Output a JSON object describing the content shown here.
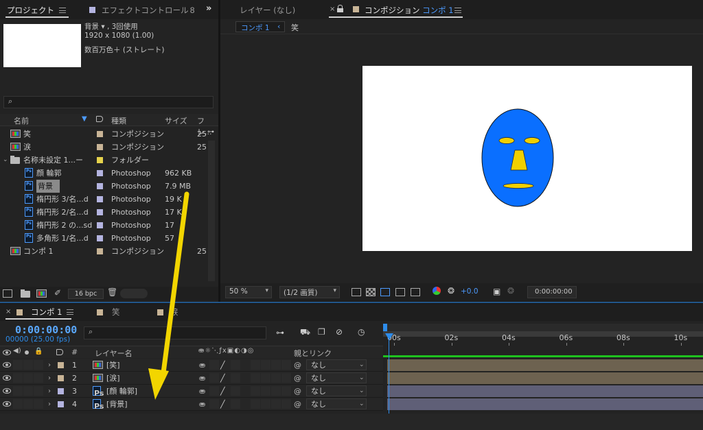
{
  "colors": {
    "accent_blue": "#2d8ceb",
    "timecode_blue": "#5aa8ff",
    "face_blue": "#0a6fff",
    "face_yellow": "#f1d000",
    "label_tan": "#c8b496",
    "label_lavender": "#b4b4e0",
    "label_yellow": "#e6d34c",
    "arrow_yellow": "#f2d500",
    "track_tan": "#6d6250",
    "track_lavender": "#5f5f77",
    "workarea_green": "#1fc21f"
  },
  "project": {
    "tab_label": "プロジェクト",
    "effect_tab_label": "エフェクトコントロール",
    "effect_tab_suffix": "8",
    "selected_name": "背景",
    "usage": "▾ , 3回使用",
    "dimensions": "1920 x 1080 (1.00)",
    "color_info": "数百万色＋ (ストレート)",
    "columns": {
      "name": "名前",
      "type": "種類",
      "size": "サイズ",
      "frame": "フレ..."
    },
    "items": [
      {
        "name": "笑",
        "type": "コンポジション",
        "size": "",
        "frame": "25",
        "icon": "comp-icon",
        "label": "tan"
      },
      {
        "name": "涙",
        "type": "コンポジション",
        "size": "",
        "frame": "25",
        "icon": "comp-icon",
        "label": "tan"
      },
      {
        "name": "名称未設定 1...ー",
        "type": "フォルダー",
        "size": "",
        "frame": "",
        "icon": "folder-icon",
        "label": "yellow"
      },
      {
        "name": "顔 輪郭",
        "type": "Photoshop",
        "size": "962 KB",
        "frame": "",
        "icon": "photoshop-icon",
        "label": "lavender"
      },
      {
        "name": "背景",
        "type": "Photoshop",
        "size": "7.9 MB",
        "frame": "",
        "icon": "photoshop-icon",
        "label": "lavender"
      },
      {
        "name": "楕円形 3/名...d",
        "type": "Photoshop",
        "size": "19 K",
        "frame": "",
        "icon": "photoshop-icon",
        "label": "lavender"
      },
      {
        "name": "楕円形 2/名...d",
        "type": "Photoshop",
        "size": "17 K",
        "frame": "",
        "icon": "photoshop-icon",
        "label": "lavender"
      },
      {
        "name": "楕円形 2 の...sd",
        "type": "Photoshop",
        "size": "17",
        "frame": "",
        "icon": "photoshop-icon",
        "label": "lavender"
      },
      {
        "name": "多角形 1/名...d",
        "type": "Photoshop",
        "size": "57",
        "frame": "",
        "icon": "photoshop-icon",
        "label": "lavender"
      },
      {
        "name": "コンポ 1",
        "type": "コンポジション",
        "size": "",
        "frame": "25",
        "icon": "comp-icon",
        "label": "tan"
      }
    ],
    "bpc_label": "16 bpc"
  },
  "viewer": {
    "layer_tab": "レイヤー (なし)",
    "comp_tab_prefix": "コンポジション",
    "comp_tab_name": "コンポ 1",
    "crumb_active": "コンポ 1",
    "crumb_next": "笑",
    "zoom": "50 %",
    "resolution": "(1/2 画質)",
    "exposure": "+0.0",
    "timecode": "0:00:00:00"
  },
  "timeline": {
    "tab_active": "コンポ 1",
    "tab_2": "笑",
    "tab_3": "涙",
    "timecode": "0:00:00:00",
    "frames_fps": "00000 (25.00 fps)",
    "search_placeholder": "",
    "col_layer_name": "レイヤー名",
    "col_parent": "親とリンク",
    "col_number": "#",
    "ruler": [
      "00s",
      "02s",
      "04s",
      "06s",
      "08s",
      "10s"
    ],
    "layers": [
      {
        "num": "1",
        "name": "[笑]",
        "parent": "なし",
        "icon": "comp-icon",
        "label": "tan"
      },
      {
        "num": "2",
        "name": "[涙]",
        "parent": "なし",
        "icon": "comp-icon",
        "label": "tan"
      },
      {
        "num": "3",
        "name": "[顔 輪郭]",
        "parent": "なし",
        "icon": "photoshop-icon",
        "label": "lavender"
      },
      {
        "num": "4",
        "name": "[背景]",
        "parent": "なし",
        "icon": "photoshop-icon",
        "label": "lavender"
      }
    ]
  }
}
